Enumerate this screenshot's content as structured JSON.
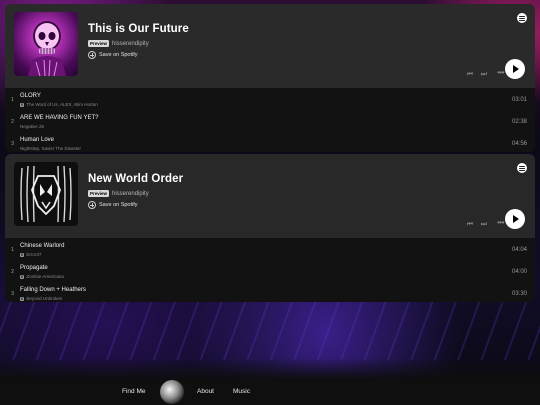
{
  "playlists": [
    {
      "title": "This is Our Future",
      "badge": "Preview",
      "owner": "hisserendipity",
      "save_label": "Save on Spotify",
      "tracks": [
        {
          "num": "1",
          "name": "GLORY",
          "artist": "The Word of Us, ALEX, Wim Horton",
          "explicit": true,
          "duration": "03:01"
        },
        {
          "num": "2",
          "name": "ARE WE HAVING FUN YET?",
          "artist": "Negative 25",
          "explicit": false,
          "duration": "02:38"
        },
        {
          "num": "3",
          "name": "Human Love",
          "artist": "Nightstep, Xavier The Disaster",
          "explicit": false,
          "duration": "04:56"
        }
      ]
    },
    {
      "title": "New World Order",
      "badge": "Preview",
      "owner": "hisserendipity",
      "save_label": "Save on Spotify",
      "tracks": [
        {
          "num": "1",
          "name": "Chinese Warlord",
          "artist": "Error37",
          "explicit": true,
          "duration": "04:04"
        },
        {
          "num": "2",
          "name": "Propagate",
          "artist": "Zombie Americana",
          "explicit": true,
          "duration": "04:00"
        },
        {
          "num": "3",
          "name": "Falling Down + Heathers",
          "artist": "Beyond Unbroken",
          "explicit": true,
          "duration": "03:30"
        }
      ]
    }
  ],
  "controls": {
    "prev": "⏮",
    "next": "⏭",
    "more": "•••",
    "explicit_badge": "E"
  },
  "footer": {
    "find_me": "Find Me",
    "about": "About",
    "music": "Music"
  },
  "icons": [
    "spotify-icon",
    "add-circle-icon",
    "previous-track-icon",
    "next-track-icon",
    "more-icon",
    "play-icon",
    "skull-cover",
    "mask-cover",
    "site-logo"
  ]
}
